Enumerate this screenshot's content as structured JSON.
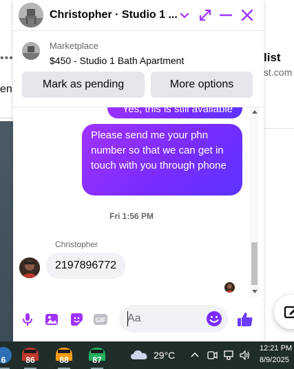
{
  "background": {
    "left_dots": "•••",
    "left_text": "en",
    "right_title": "list",
    "right_sub": "st.com"
  },
  "chat": {
    "title": "Christopher · Studio 1 ...",
    "accent_color": "#a033ff",
    "header_icons": [
      "chevron-down-icon",
      "expand-icon",
      "minimize-icon",
      "close-icon"
    ],
    "listing": {
      "kind": "Marketplace",
      "title": "$450 - Studio 1 Bath Apartment",
      "buttons": [
        "Mark as pending",
        "More options"
      ]
    },
    "messages": {
      "partial_out": "Yes, this is still available",
      "out_long": "Please send me your phn number so that we can get in touch with you through phone",
      "timestamp": "Fri 1:56 PM",
      "sender": "Christopher",
      "in_text": "2197896772"
    },
    "composer": {
      "placeholder": "Aa",
      "icons": [
        "microphone-icon",
        "photo-icon",
        "sticker-icon",
        "gif-icon",
        "emoji-icon",
        "thumbs-up-icon"
      ]
    }
  },
  "taskbar": {
    "apps": [
      {
        "badge": "6",
        "color": "#2f6fb7"
      },
      {
        "badge": "86",
        "color": "#c0392b"
      },
      {
        "badge": "88",
        "color": "#f39c12"
      },
      {
        "badge": "87",
        "color": "#27ae60"
      }
    ],
    "weather": "29°C",
    "time": "12:21 PM",
    "date": "8/9/2025"
  }
}
